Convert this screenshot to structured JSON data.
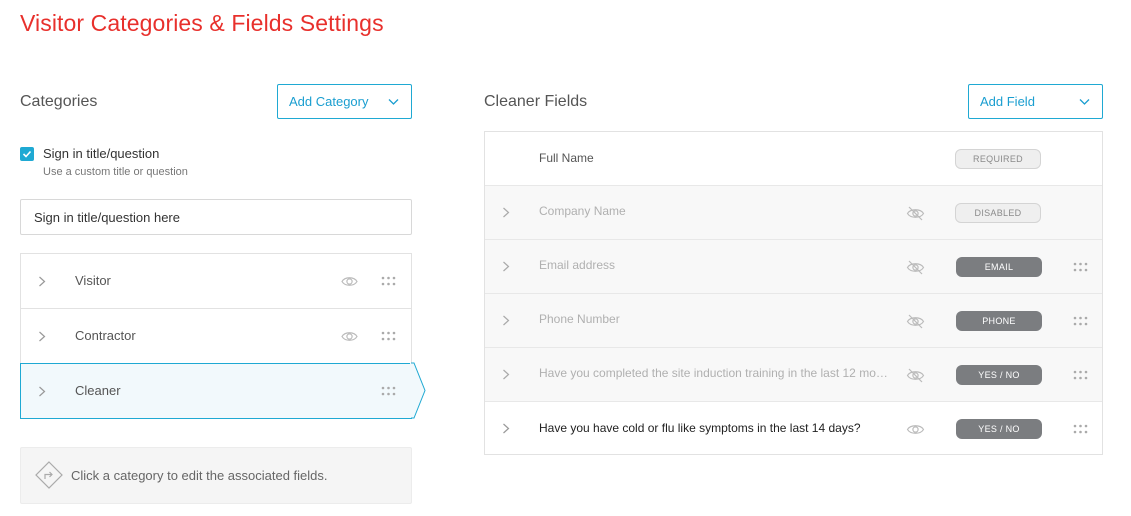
{
  "page": {
    "title": "Visitor Categories & Fields Settings"
  },
  "categories": {
    "title": "Categories",
    "add_button": "Add Category",
    "sign_in": {
      "checkbox_label": "Sign in title/question",
      "checked": true,
      "help": "Use a custom title or question",
      "input_placeholder": "Sign in title/question here"
    },
    "items": [
      {
        "label": "Visitor",
        "icon": "eye-icon"
      },
      {
        "label": "Contractor",
        "icon": "eye-icon"
      },
      {
        "label": "Cleaner",
        "selected": true
      }
    ],
    "hint": "Click a category to edit the associated fields."
  },
  "fields": {
    "title": "Cleaner Fields",
    "add_button": "Add Field",
    "rows": [
      {
        "label": "Full Name",
        "badge": "REQUIRED"
      },
      {
        "label": "Company Name",
        "badge": "DISABLED",
        "icon": "eye-off-icon"
      },
      {
        "label": "Email address",
        "badge": "EMAIL",
        "icon": "eye-off-icon"
      },
      {
        "label": "Phone Number",
        "badge": "PHONE",
        "icon": "eye-off-icon"
      },
      {
        "label": "Have you completed the site induction training in the last 12 mo…",
        "badge": "YES / NO",
        "icon": "eye-off-icon"
      },
      {
        "label": "Have you have cold or flu like symptoms in the last 14 days?",
        "badge": "YES / NO",
        "icon": "eye-icon"
      }
    ]
  },
  "colors": {
    "accent": "#1fa9d3",
    "title": "#e8302c",
    "badge_fill": "#7b7d80"
  }
}
